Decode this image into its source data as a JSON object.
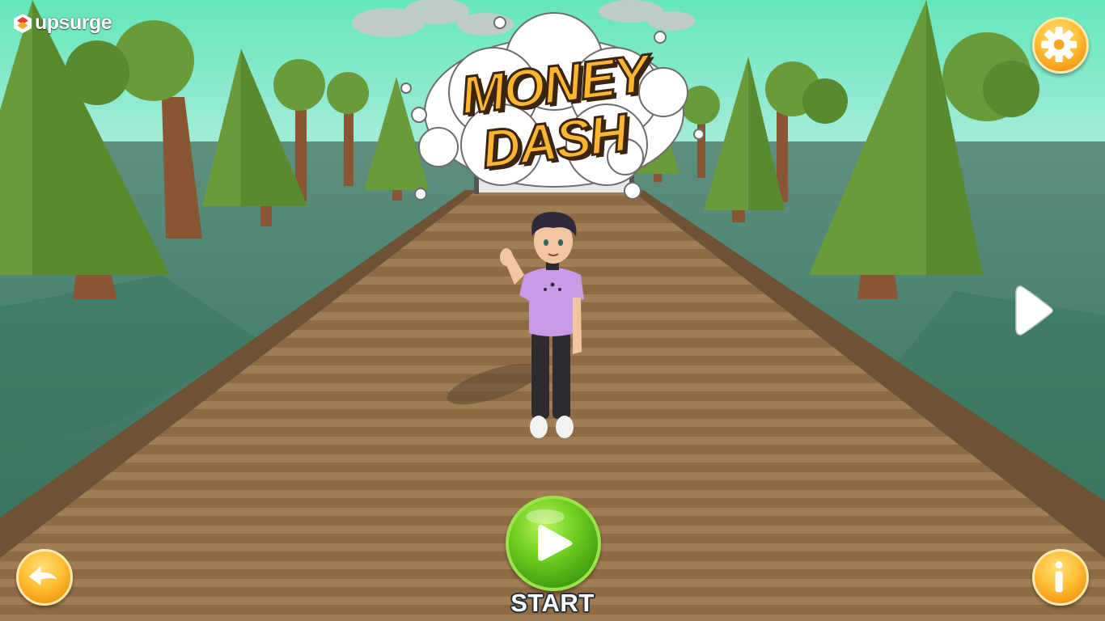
{
  "app": {
    "brand": "upsurge",
    "game_title_line1": "MONEY",
    "game_title_line2": "DASH"
  },
  "controls": {
    "start_label": "START",
    "settings_icon": "gear-icon",
    "back_icon": "back-arrow-icon",
    "info_icon": "info-icon",
    "next_icon": "next-arrow-icon",
    "start_icon": "play-icon"
  },
  "colors": {
    "sky": "#6fe6b8",
    "ground": "#3d7f66",
    "path": "#8f6c45",
    "accent_orange": "#ffb62e",
    "start_green": "#5bbd17"
  }
}
